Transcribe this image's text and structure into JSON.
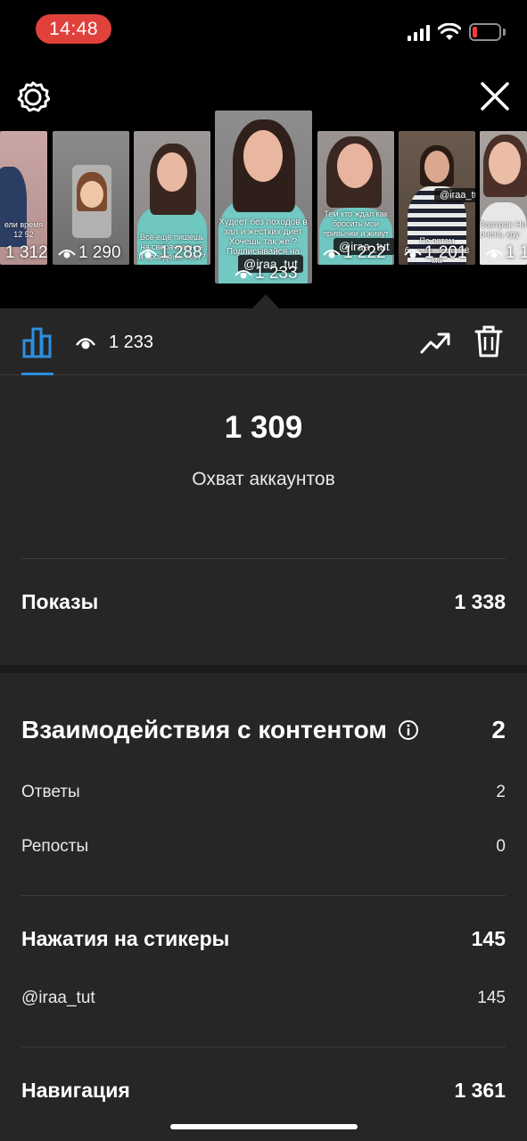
{
  "status_bar": {
    "time": "14:48"
  },
  "stories": [
    {
      "views": "1 312",
      "caption": "ели время 12 52"
    },
    {
      "views": "1 290"
    },
    {
      "views": "1 288",
      "caption": "Всё ещё пишешь на сворачивание и пройдёшь тест?"
    },
    {
      "views": "1 233",
      "handle": "@iraa_tut",
      "caption": "Худеет без походов в зал и жестких диет Хочешь так же ? Подписывайся на"
    },
    {
      "views": "1 222",
      "handle": "@iraa_tut",
      "caption": "Тем кто ждал как бросить мои привычки и живут"
    },
    {
      "views": "1 201",
      "handle": "@iraa_tut",
      "caption": "По пятам беременность - 3 ма"
    },
    {
      "views": "1 1",
      "caption": "Завтрак Не очень кру"
    }
  ],
  "tabbar": {
    "views_count": "1 233"
  },
  "reach": {
    "value": "1 309",
    "label": "Охват аккаунтов"
  },
  "impressions": {
    "label": "Показы",
    "value": "1 338"
  },
  "interactions": {
    "label": "Взаимодействия с контентом",
    "value": "2",
    "items": [
      {
        "label": "Ответы",
        "value": "2"
      },
      {
        "label": "Репосты",
        "value": "0"
      }
    ]
  },
  "sticker_taps": {
    "label": "Нажатия на стикеры",
    "value": "145",
    "items": [
      {
        "label": "@iraa_tut",
        "value": "145"
      }
    ]
  },
  "navigation": {
    "label": "Навигация",
    "value": "1 361"
  },
  "colors": {
    "accent": "#2d8fe0",
    "panel": "#262626",
    "time_pill": "#e0413b"
  }
}
